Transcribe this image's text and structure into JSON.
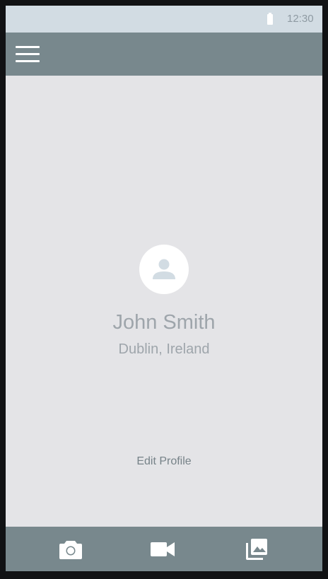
{
  "status_bar": {
    "time": "12:30",
    "battery_icon": "battery-icon"
  },
  "app_bar": {
    "menu_icon": "menu-icon"
  },
  "profile": {
    "avatar_icon": "person-icon",
    "name": "John Smith",
    "location": "Dublin, Ireland",
    "edit_label": "Edit Profile"
  },
  "bottom_nav": {
    "items": [
      {
        "icon": "camera-icon"
      },
      {
        "icon": "video-camera-icon"
      },
      {
        "icon": "photo-library-icon"
      }
    ]
  },
  "colors": {
    "status_bar_bg": "#d2dce3",
    "app_bar_bg": "#78888d",
    "screen_bg": "#e4e4e7",
    "text_muted": "#9ea5ab",
    "icon_white": "#ffffff"
  }
}
